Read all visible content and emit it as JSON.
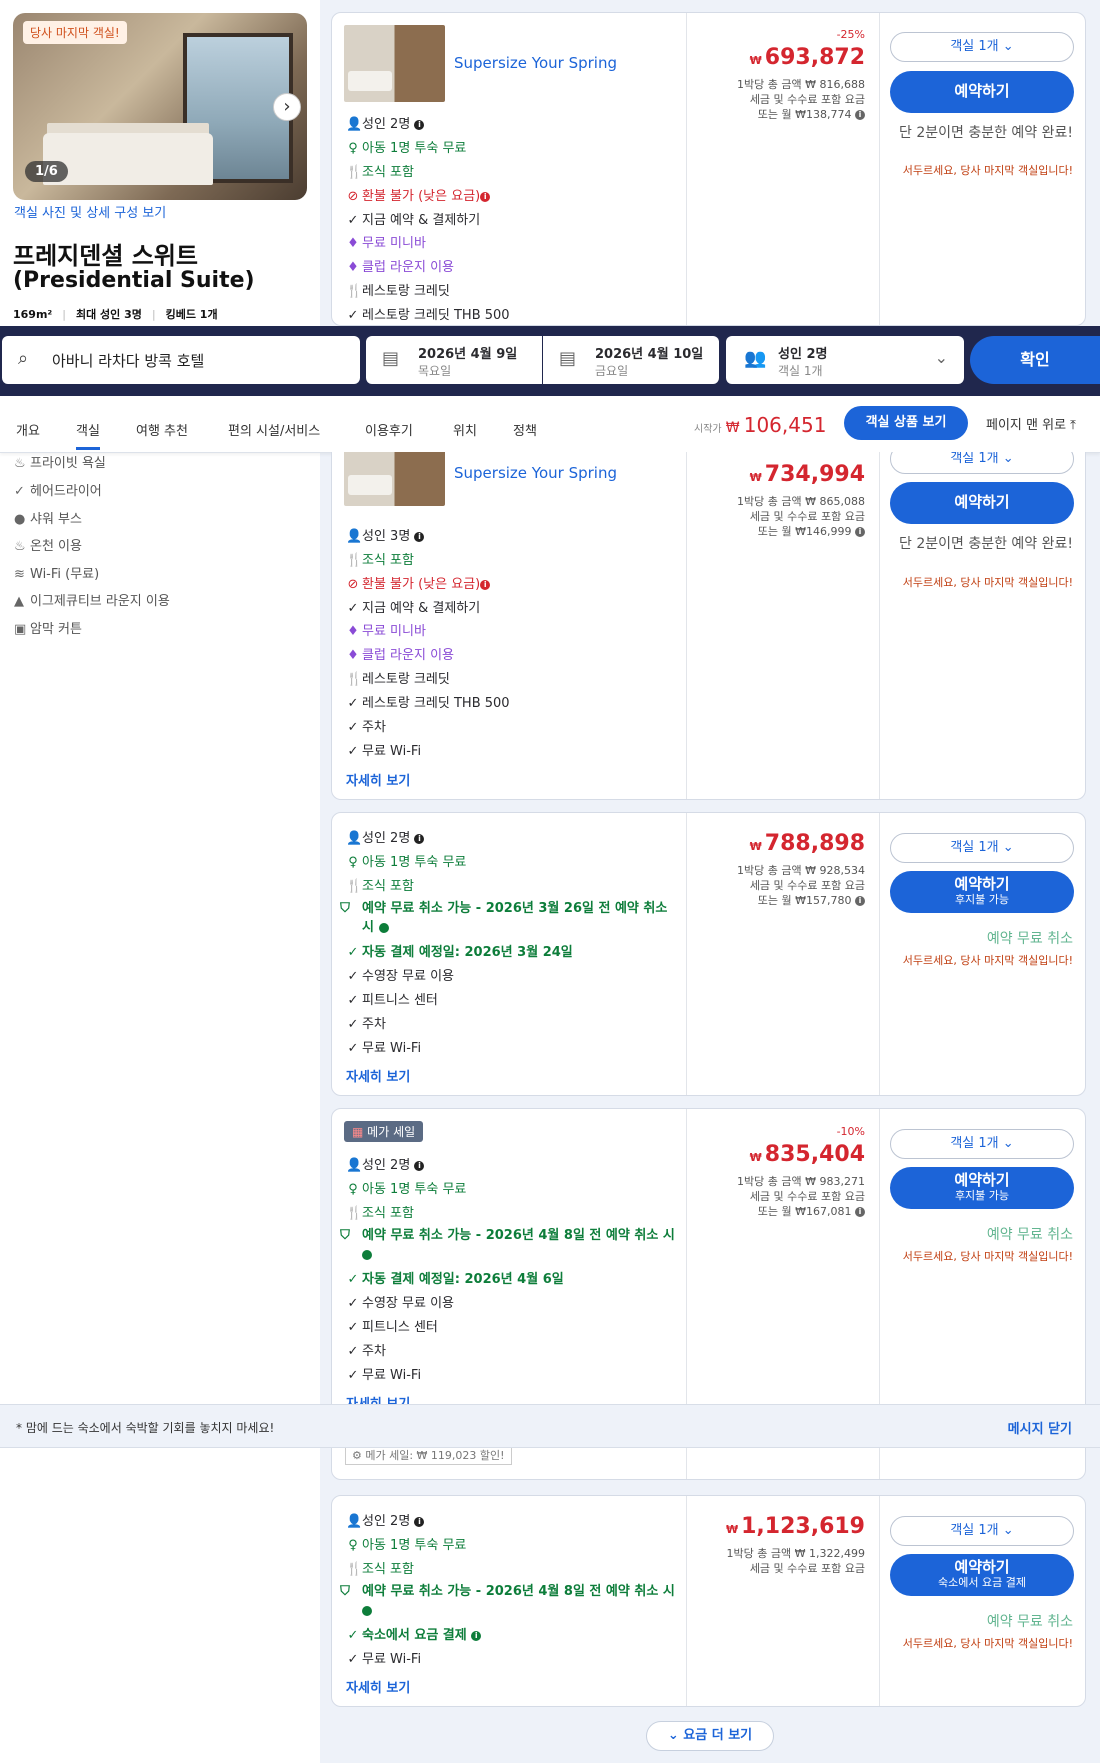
{
  "room": {
    "photo_tag": "당사 마지막 객실!",
    "photo_count": "1/6",
    "photo_link": "객실 사진 및 상세 구성 보기",
    "name_ko": "프레지덴셜 스위트",
    "name_en": "(Presidential Suite)",
    "size": "169m²",
    "max_guests": "최대 성인 3명",
    "bed": "킹베드 1개"
  },
  "amenities": [
    "프라이빗 욕실",
    "헤어드라이어",
    "샤워 부스",
    "온천 이용",
    "Wi-Fi (무료)",
    "이그제큐티브 라운지 이용",
    "암막 커튼"
  ],
  "search": {
    "hotel": "아바니 라차다 방콕 호텔",
    "checkin_date": "2026년 4월 9일",
    "checkin_day": "목요일",
    "checkout_date": "2026년 4월 10일",
    "checkout_day": "금요일",
    "guests": "성인 2명",
    "rooms": "객실 1개",
    "confirm": "확인"
  },
  "tabs": [
    "개요",
    "객실",
    "여행 추천",
    "편의 시설/서비스",
    "이용후기",
    "위치",
    "정책"
  ],
  "pricebar": {
    "from_label": "시작가",
    "currency": "₩",
    "from_price": "106,451",
    "view_btn": "객실 상품 보기",
    "top_btn": "페이지 맨 위로"
  },
  "offers": [
    {
      "promo": "Supersize Your Spring",
      "discount": "-25%",
      "price": "693,872",
      "total": "1박당 총 금액 ₩ 816,688",
      "tax": "세금 및 수수료 포함 요금",
      "monthly": "또는 월 ₩138,774",
      "features": [
        "성인 2명",
        "아동 1명 투숙 무료",
        "조식 포함",
        "환불 불가 (낮은 요금)",
        "지금 예약 & 결제하기",
        "무료 미니바",
        "클럽 라운지 이용",
        "레스토랑 크레딧",
        "레스토랑 크레딧 THB 500"
      ],
      "room_select": "객실 1개",
      "book": "예약하기",
      "note": "단 2분이면 충분한 예약 완료!",
      "warn": "서두르세요, 당사 마지막 객실입니다!"
    },
    {
      "promo": "Supersize Your Spring",
      "price": "734,994",
      "total": "1박당 총 금액 ₩ 865,088",
      "tax": "세금 및 수수료 포함 요금",
      "monthly": "또는 월 ₩146,999",
      "features": [
        "성인 3명",
        "조식 포함",
        "환불 불가 (낮은 요금)",
        "지금 예약 & 결제하기",
        "무료 미니바",
        "클럽 라운지 이용",
        "레스토랑 크레딧",
        "레스토랑 크레딧 THB 500",
        "주차",
        "무료 Wi-Fi"
      ],
      "more": "자세히 보기",
      "room_select": "객실 1개",
      "book": "예약하기",
      "note": "단 2분이면 충분한 예약 완료!",
      "warn": "서두르세요, 당사 마지막 객실입니다!"
    },
    {
      "price": "788,898",
      "total": "1박당 총 금액 ₩ 928,534",
      "tax": "세금 및 수수료 포함 요금",
      "monthly": "또는 월 ₩157,780",
      "features": [
        "성인 2명",
        "아동 1명 투숙 무료",
        "조식 포함",
        "예약 무료 취소 가능 - 2026년 3월 26일 전 예약 취소 시",
        "자동 결제 예정일: 2026년 3월 24일",
        "수영장 무료 이용",
        "피트니스 센터",
        "주차",
        "무료 Wi-Fi"
      ],
      "more": "자세히 보기",
      "room_select": "객실 1개",
      "book": "예약하기",
      "book_sub": "후지불 가능",
      "free_cancel": "예약 무료 취소",
      "warn": "서두르세요, 당사 마지막 객실입니다!"
    },
    {
      "badge": "메가 세일",
      "discount": "-10%",
      "price": "835,404",
      "total": "1박당 총 금액 ₩ 983,271",
      "tax": "세금 및 수수료 포함 요금",
      "monthly": "또는 월 ₩167,081",
      "features": [
        "성인 2명",
        "아동 1명 투숙 무료",
        "조식 포함",
        "예약 무료 취소 가능 - 2026년 4월 8일 전 예약 취소 시",
        "자동 결제 예정일: 2026년 4월 6일",
        "수영장 무료 이용",
        "피트니스 센터",
        "주차",
        "무료 Wi-Fi"
      ],
      "more": "자세히 보기",
      "sale_note": "메가 세일: ₩ 119,023 할인!",
      "room_select": "객실 1개",
      "book": "예약하기",
      "book_sub": "후지불 가능",
      "free_cancel": "예약 무료 취소",
      "warn": "서두르세요, 당사 마지막 객실입니다!"
    },
    {
      "price": "1,123,619",
      "total": "1박당 총 금액 ₩ 1,322,499",
      "tax": "세금 및 수수료 포함 요금",
      "features": [
        "성인 2명",
        "아동 1명 투숙 무료",
        "조식 포함",
        "예약 무료 취소 가능 - 2026년 4월 8일 전 예약 취소 시",
        "숙소에서 요금 결제",
        "무료 Wi-Fi"
      ],
      "more": "자세히 보기",
      "room_select": "객실 1개",
      "book": "예약하기",
      "book_sub": "숙소에서 요금 결제",
      "free_cancel": "예약 무료 취소",
      "warn": "서두르세요, 당사 마지막 객실입니다!"
    }
  ],
  "toast": {
    "message": "* 맘에 드는 숙소에서 숙박할 기회를 놓치지 마세요!",
    "close": "메시지 닫기"
  },
  "more_rates": "요금 더 보기",
  "colors": {
    "primary": "#1c64d8",
    "price": "#d4262f",
    "green": "#0d7d3a",
    "nav": "#20274d"
  }
}
